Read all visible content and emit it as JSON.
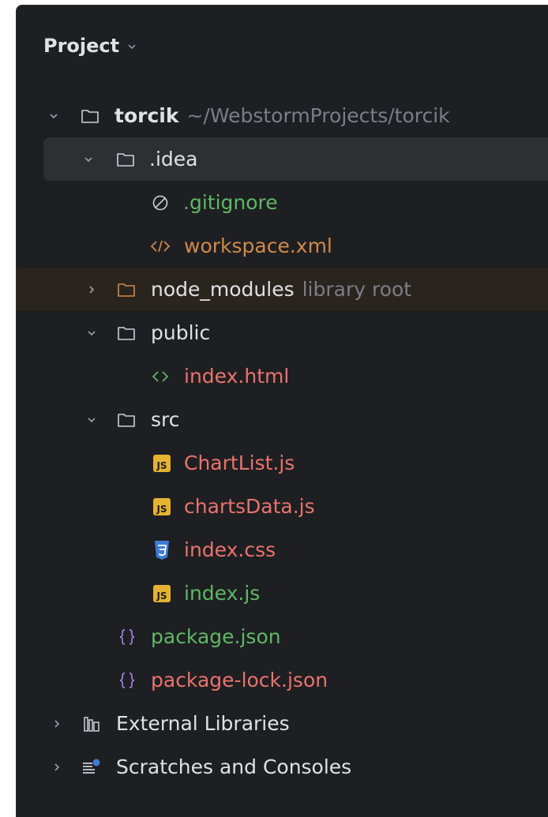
{
  "header": {
    "title": "Project"
  },
  "tree": {
    "root": {
      "name": "torcik",
      "path": "~/WebstormProjects/torcik"
    },
    "idea": {
      "name": ".idea"
    },
    "gitignore": {
      "name": ".gitignore"
    },
    "workspace": {
      "name": "workspace.xml"
    },
    "node_modules": {
      "name": "node_modules",
      "hint": "library root"
    },
    "public": {
      "name": "public"
    },
    "index_html": {
      "name": "index.html"
    },
    "src": {
      "name": "src"
    },
    "chartlist": {
      "name": "ChartList.js"
    },
    "chartsdata": {
      "name": "chartsData.js"
    },
    "index_css": {
      "name": "index.css"
    },
    "index_js": {
      "name": "index.js"
    },
    "package_json": {
      "name": "package.json"
    },
    "package_lock": {
      "name": "package-lock.json"
    },
    "external_libraries": {
      "name": "External Libraries"
    },
    "scratches": {
      "name": "Scratches and Consoles"
    }
  },
  "icons": {
    "js_badge": "JS"
  },
  "colors": {
    "background": "#1e1f22",
    "selected_row": "#2d2f33",
    "library_root_row": "#2a241f",
    "text_default": "#dfe1e5",
    "text_green": "#5fb865",
    "text_orange": "#d08a4a",
    "text_red": "#e9736d",
    "text_hint": "#7a7e85",
    "js_badge": "#e5b232",
    "css_badge": "#3e7bd6",
    "json_icon": "#a77de8"
  }
}
